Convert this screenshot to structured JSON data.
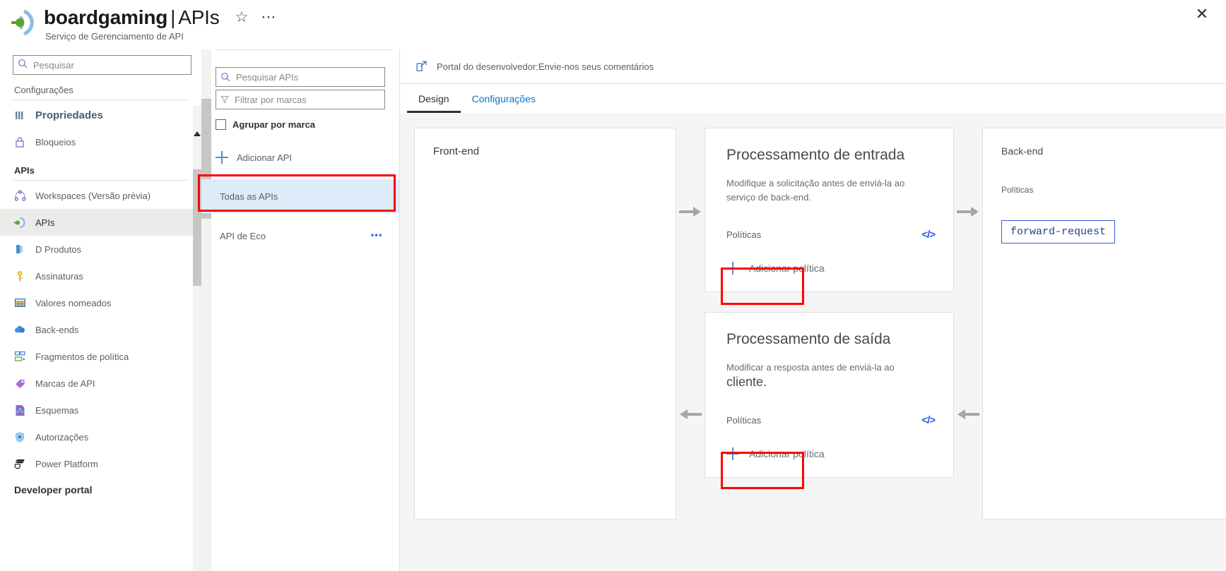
{
  "header": {
    "title_main": "boardgaming",
    "title_sep": "|",
    "title_sub": "APIs",
    "subtitle": "Serviço de Gerenciamento de API",
    "favorite_icon": "star-icon",
    "more_icon": "ellipsis-icon",
    "close_icon": "close-icon"
  },
  "leftnav": {
    "search_placeholder": "Pesquisar",
    "search_value": "",
    "collapse_label": "«",
    "sections": [
      {
        "label": "Configurações",
        "bold": false
      },
      {
        "label": "APIs",
        "bold": true
      }
    ],
    "items": [
      {
        "label": "Propriedades",
        "icon": "properties-icon",
        "state": "strong"
      },
      {
        "label": "Bloqueios",
        "icon": "lock-icon",
        "state": "normal"
      },
      {
        "label": "Workspaces (Versão prévia)",
        "icon": "workspaces-icon",
        "state": "normal"
      },
      {
        "label": "APIs",
        "icon": "apis-icon",
        "state": "selected"
      },
      {
        "label": "D Produtos",
        "icon": "products-icon",
        "state": "normal"
      },
      {
        "label": "Assinaturas",
        "icon": "key-icon",
        "state": "normal"
      },
      {
        "label": "Valores nomeados",
        "icon": "named-values-icon",
        "state": "normal"
      },
      {
        "label": "Back-ends",
        "icon": "backends-cloud-icon",
        "state": "normal"
      },
      {
        "label": "Fragmentos de política",
        "icon": "policy-fragments-icon",
        "state": "normal"
      },
      {
        "label": "Marcas de API",
        "icon": "tag-icon",
        "state": "normal"
      },
      {
        "label": "Esquemas",
        "icon": "schemas-icon",
        "state": "normal"
      },
      {
        "label": "Autorizações",
        "icon": "shield-icon",
        "state": "normal"
      },
      {
        "label": "Power Platform",
        "icon": "power-platform-icon",
        "state": "normal"
      }
    ],
    "footer_section": "Developer portal"
  },
  "apilist": {
    "search_placeholder": "Pesquisar APIs",
    "search_value": "",
    "tag_filter_placeholder": "Filtrar por marcas",
    "tag_filter_value": "",
    "tag_filter_icon": "filter-icon",
    "group_by_tag_label": "Agrupar por marca",
    "group_by_tag_checked": false,
    "add_api_label": "Adicionar API",
    "items": [
      {
        "label": "Todas as APIs",
        "selected": true,
        "highlighted": true,
        "has_menu": false
      },
      {
        "label": "API de Eco",
        "selected": false,
        "highlighted": false,
        "has_menu": true
      }
    ],
    "menu_icon": "ellipsis-icon"
  },
  "main": {
    "dev_portal_link": "Portal do desenvolvedor:Envie-nos seus comentários",
    "dev_portal_icon": "external-link-icon",
    "tabs": [
      {
        "label": "Design",
        "active": true
      },
      {
        "label": "Configurações",
        "active": false
      }
    ],
    "frontend": {
      "title": "Front-end"
    },
    "inbound": {
      "title": "Processamento de entrada",
      "description": "Modifique a solicitação antes de enviá-la ao serviço de back-end.",
      "policies_label": "Políticas",
      "code_icon": "code-brackets-icon",
      "add_policy_label": "Adicionar política",
      "add_policy_icon": "plus-icon"
    },
    "outbound": {
      "title": "Processamento de saída",
      "description_part1": "Modificar a resposta antes de enviá-la ao ",
      "description_part2": "cliente.",
      "policies_label": "Políticas",
      "code_icon": "code-brackets-icon",
      "add_policy_label": "Adicionar política",
      "add_policy_icon": "plus-icon"
    },
    "backend": {
      "title": "Back-end",
      "policies_label": "Políticas",
      "chip_label": "forward-request"
    },
    "arrow_right_icon": "arrow-right-icon",
    "arrow_left_icon": "arrow-left-icon"
  },
  "colors": {
    "accent": "#0078d4",
    "annotation": "#ff0000",
    "selected_row": "#deecf9",
    "canvas": "#f5f5f5"
  }
}
